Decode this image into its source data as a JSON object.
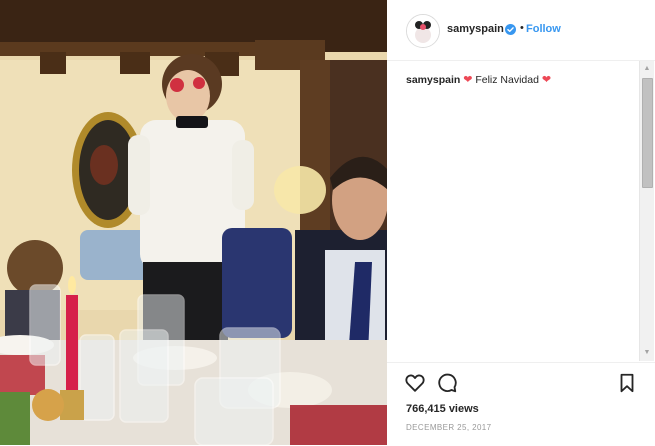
{
  "post": {
    "username": "samyspain",
    "follow_label": "Follow",
    "separator": "•",
    "caption_text": "Feliz Navidad",
    "views_text": "766,415 views",
    "date": "DECEMBER 25, 2017"
  },
  "icons": {
    "verified": "verified-badge-icon",
    "like": "heart-outline-icon",
    "comment": "speech-bubble-icon",
    "save": "bookmark-icon",
    "caption_heart": "red-heart-emoji"
  },
  "colors": {
    "follow": "#3897f0",
    "verified": "#3897f0",
    "heart": "#ed4956",
    "text": "#262626",
    "muted": "#999999"
  }
}
